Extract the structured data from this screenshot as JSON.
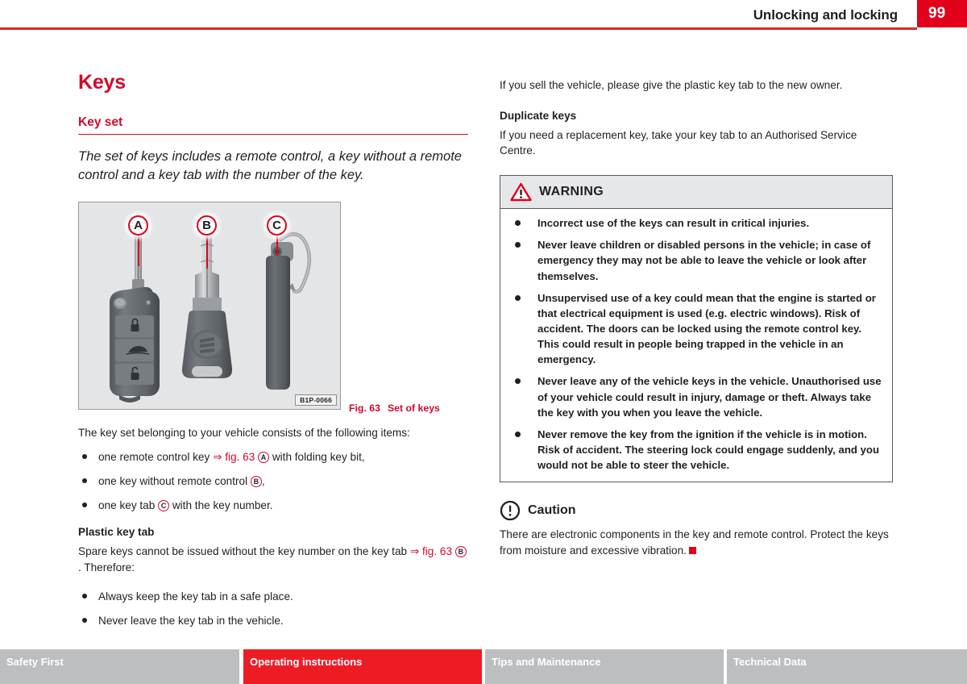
{
  "header": {
    "title": "Unlocking and locking",
    "page_number": "99"
  },
  "left_column": {
    "section_title": "Keys",
    "sub_title": "Key set",
    "lead": "The set of keys includes a remote control, a key without a remote control and a key tab with the number of the key.",
    "figure": {
      "code": "B1P-0066",
      "caption_label": "Fig. 63",
      "caption_text": "Set of keys",
      "callouts": [
        "A",
        "B",
        "C"
      ],
      "alt": "Illustration of three keys: a remote control key with folding key bit, a key without remote control, and a plastic key tab"
    },
    "intro": "The key set belonging to your vehicle consists of the following items:",
    "items": [
      {
        "pre": "one remote control key ",
        "ref": "⇒ fig. 63",
        "circle": "A",
        "post": " with folding key bit,"
      },
      {
        "pre": "one key without remote control ",
        "ref": "",
        "circle": "B",
        "post": ","
      },
      {
        "pre": "one key tab ",
        "ref": "",
        "circle": "C",
        "post": " with the key number."
      }
    ],
    "plastic_key_tab": {
      "heading": "Plastic key tab",
      "pre": "Spare keys cannot be issued without the key number on the key tab ",
      "ref": "⇒ fig. 63",
      "circle": "B",
      "post": ". Therefore:",
      "items": [
        "Always keep the key tab in a safe place.",
        "Never leave the key tab in the vehicle."
      ]
    }
  },
  "right_column": {
    "intro": "If you sell the vehicle, please give the plastic key tab to the new owner.",
    "duplicate_keys": {
      "heading": "Duplicate keys",
      "text": "If you need a replacement key, take your key tab to an Authorised Service Centre."
    },
    "warning": {
      "label": "WARNING",
      "items": [
        "Incorrect use of the keys can result in critical injuries.",
        "Never leave children or disabled persons in the vehicle; in case of emergency they may not be able to leave the vehicle or look after themselves.",
        "Unsupervised use of a key could mean that the engine is started or that electrical equipment is used (e.g. electric windows). Risk of accident. The doors can be locked using the remote control key. This could result in people being trapped in the vehicle in an emergency.",
        "Never leave any of the vehicle keys in the vehicle. Unauthorised use of your vehicle could result in injury, damage or theft. Always take the key with you when you leave the vehicle.",
        "Never remove the key from the ignition if the vehicle is in motion. Risk of accident. The steering lock could engage suddenly, and you would not be able to steer the vehicle."
      ]
    },
    "caution": {
      "label": "Caution",
      "text": "There are electronic components in the key and remote control. Protect the keys from moisture and excessive vibration."
    }
  },
  "footer": {
    "tabs": [
      {
        "label": "Safety First",
        "active": false
      },
      {
        "label": "Operating instructions",
        "active": true
      },
      {
        "label": "Tips and Maintenance",
        "active": false
      },
      {
        "label": "Technical Data",
        "active": false
      }
    ]
  },
  "colors": {
    "brand_red": "#cf0a2c",
    "accent_red": "#e2001a",
    "tab_red": "#ed1c24",
    "tab_grey": "#bcbec0",
    "ink": "#231f20"
  }
}
